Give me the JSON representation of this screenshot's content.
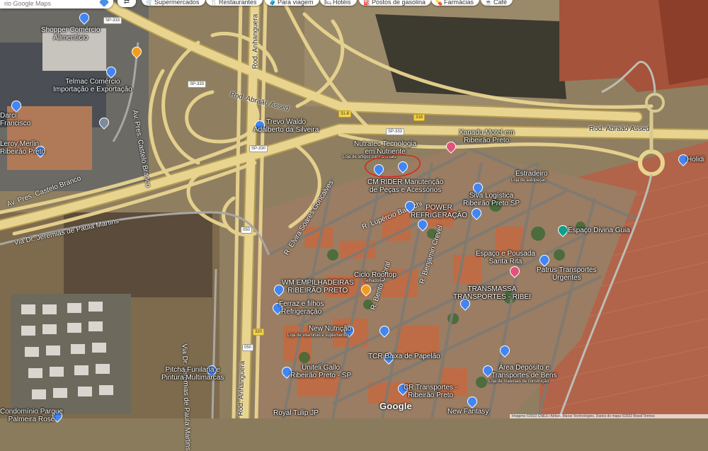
{
  "search": {
    "placeholder": "rio Google Maps"
  },
  "toolbar": {
    "directions_label": "⇄",
    "chips": [
      {
        "icon": "cart-icon",
        "glyph": "🛒",
        "label": "Supermercados"
      },
      {
        "icon": "fork-knife-icon",
        "glyph": "🍴",
        "label": "Restaurantes"
      },
      {
        "icon": "suitcase-icon",
        "glyph": "🧳",
        "label": "Para viagem"
      },
      {
        "icon": "bed-icon",
        "glyph": "🛏",
        "label": "Hotéis"
      },
      {
        "icon": "fuel-icon",
        "glyph": "⛽",
        "label": "Postos de gasolina"
      },
      {
        "icon": "pharmacy-icon",
        "glyph": "💊",
        "label": "Farmácias"
      },
      {
        "icon": "cafe-icon",
        "glyph": "☕",
        "label": "Café"
      }
    ]
  },
  "roads": {
    "abraao_assed_1": "Rod. Abraão Assed",
    "abraao_assed_2": "Rod. Abraão Assed",
    "anhanguera_north": "Rod. Anhanguera",
    "anhanguera_south": "Rod. Anhanguera",
    "castelo_branco_1": "Av. Pres. Castelo Branco",
    "castelo_branco_2": "Av. Pres. Castelo Branco",
    "jeremias": "Via Dr. Jeremias de Paula Martins",
    "jeremias_v": "Via Dr. Jeremias de Paula Martins",
    "lupercio": "R. Lupércio Bartochi",
    "benjamin": "R. Benjamin Crevel",
    "bento": "R. Bento Cabral",
    "elvira": "R. Elvira Soares Goncalves",
    "sp333_a": "SP-333",
    "sp333_b": "SP-333",
    "sp333_c": "SP-333",
    "sp330_a": "SP-330",
    "s050_a": "050",
    "s050_b": "050",
    "s320": "320",
    "s31": "31-8",
    "s318": "318"
  },
  "places": {
    "shopper": "Shopper Comércio\nAlimentício",
    "telmac": "Telmac Comércio\nImportação e Exportação",
    "leroy": "Leroy Merlin\nRibeirão Preto",
    "darci": "Darci\nFrancisco",
    "trevo": "Trevo Waldo\nAdalberto da Silveira",
    "nutratec": "Nutratec Tecnologia\nem Nutriente",
    "nutratec_sub": "Loja de artigos para animais",
    "cmrider": "CM RIDER Manutenção\nde Peças e Acessórios",
    "xanadu": "Xanadu Motel em\nRibeirão Preto",
    "estradeiro": "Estradeiro",
    "estradeiro_sub": "Loja de autopeças",
    "holiday": "Holidi",
    "siva": "Siva Logística\nRibeirão Preto SP",
    "power": "POWER\nREFRIGERAÇÃO",
    "divina": "Espaço Divina Guia",
    "pousada": "Espaço e Pousada\nSanta Rita",
    "patrus": "Patrus Transportes\nUrgentes",
    "ciclo": "Ciclo Rooftop",
    "ciclo_sub": "Telhados",
    "wm": "WM EMPILHADEIRAS\nRIBEIRÃO PRETO",
    "ferraz": "Ferraz e filhos\nRefrigeração",
    "transmassa": "TRANSMASSA\nTRANSPORTES - RIBEI",
    "newnutri": "New Nutrição",
    "newnutri_sub": "Loja de vitaminas e suplementos",
    "tcr": "TCR Baixa de Papelão",
    "uniteli": "Uniteli Gallo\nRibeirão Preto - SP",
    "area": "Área Depósito e\nTransportes de Bens",
    "area_sub": "Loja de materiais de construção",
    "cr": "CR Transportes -\nRibeirão Preto",
    "pitcha": "Pitcha Funilaria e\nPintura Multimarcas",
    "condominio": "Condomínio Parque\nPalmeira Rose",
    "royal": "Royal Tulip JP",
    "newfantasy": "New Fantasy"
  },
  "footer": {
    "google": "Google",
    "attribution": "Imagens ©2022 CNES / Airbus, Maxar Technologies, Dados do mapa ©2022  Brasil  Termos"
  },
  "colors": {
    "highway": "#e9d48f",
    "highway_edge": "#b39c55",
    "annotation": "#e0241b",
    "pin_blue": "#4285f4"
  }
}
